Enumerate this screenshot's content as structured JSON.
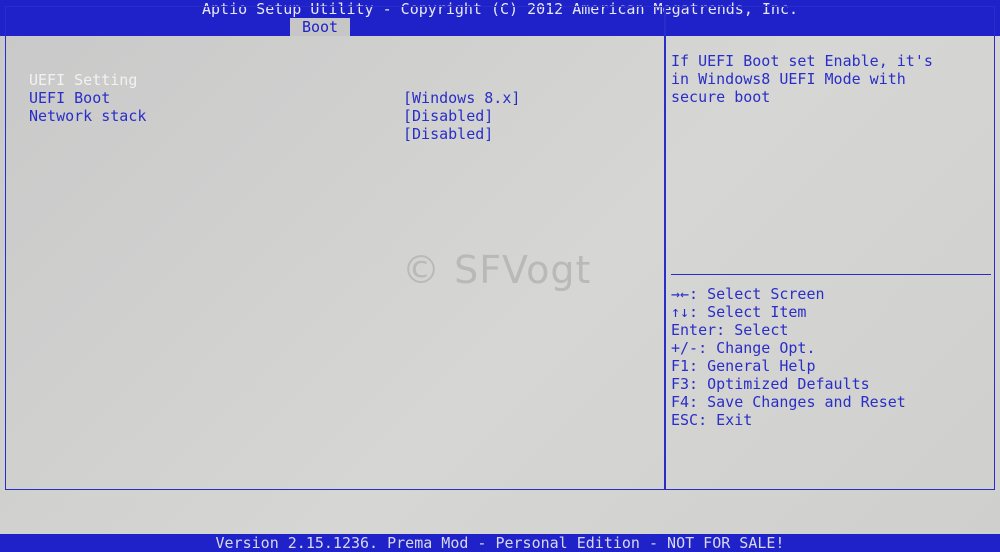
{
  "header": {
    "title": "Aptio Setup Utility - Copyright (C) 2012 American Megatrends, Inc."
  },
  "tabs": [
    {
      "label": "Boot"
    }
  ],
  "settings": [
    {
      "label": "UEFI Setting",
      "value": "[Windows 8.x]"
    },
    {
      "label": "UEFI Boot",
      "value": "[Disabled]"
    },
    {
      "label": "Network stack",
      "value": "[Disabled]"
    }
  ],
  "help": {
    "text": "If UEFI Boot set Enable, it's\nin Windows8 UEFI Mode with\nsecure boot"
  },
  "keys": [
    "→←: Select Screen",
    "↑↓: Select Item",
    "Enter: Select",
    "+/-: Change Opt.",
    "F1: General Help",
    "F3: Optimized Defaults",
    "F4: Save Changes and Reset",
    "ESC: Exit"
  ],
  "watermark": "© SFVogt",
  "footer": {
    "text": "Version 2.15.1236. Prema Mod - Personal Edition - NOT FOR SALE!"
  },
  "colors": {
    "background_blue": "#1f22c8",
    "panel_gray": "#cfcfcd",
    "text_blue": "#2a2ec8",
    "highlight_white": "#f2f2f2"
  }
}
